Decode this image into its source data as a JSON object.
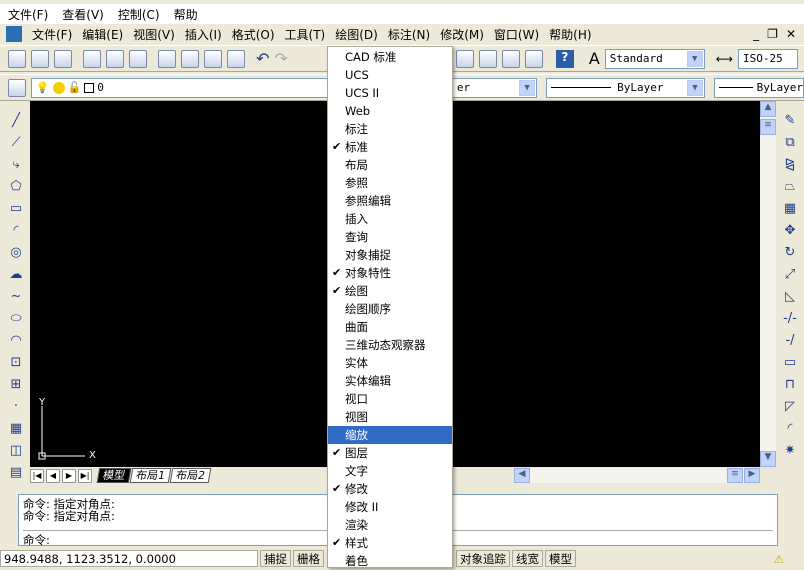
{
  "menubar": [
    "文件(F)",
    "查看(V)",
    "控制(C)",
    "帮助"
  ],
  "menubar2": [
    "文件(F)",
    "编辑(E)",
    "视图(V)",
    "插入(I)",
    "格式(O)",
    "工具(T)",
    "绘图(D)",
    "标注(N)",
    "修改(M)",
    "窗口(W)",
    "帮助(H)"
  ],
  "window_controls": [
    "_",
    "❐",
    "✕"
  ],
  "toolbar": {
    "text_style": "Standard",
    "dim_style": "ISO-25"
  },
  "layer": {
    "current": "0",
    "color": "er",
    "linetype": "ByLayer",
    "lineweight": "ByLayer"
  },
  "menu": {
    "items": [
      {
        "label": "CAD 标准",
        "checked": false
      },
      {
        "label": "UCS",
        "checked": false
      },
      {
        "label": "UCS II",
        "checked": false
      },
      {
        "label": "Web",
        "checked": false
      },
      {
        "label": "标注",
        "checked": false
      },
      {
        "label": "标准",
        "checked": true
      },
      {
        "label": "布局",
        "checked": false
      },
      {
        "label": "参照",
        "checked": false
      },
      {
        "label": "参照编辑",
        "checked": false
      },
      {
        "label": "插入",
        "checked": false
      },
      {
        "label": "查询",
        "checked": false
      },
      {
        "label": "对象捕捉",
        "checked": false
      },
      {
        "label": "对象特性",
        "checked": true
      },
      {
        "label": "绘图",
        "checked": true
      },
      {
        "label": "绘图顺序",
        "checked": false
      },
      {
        "label": "曲面",
        "checked": false
      },
      {
        "label": "三维动态观察器",
        "checked": false
      },
      {
        "label": "实体",
        "checked": false
      },
      {
        "label": "实体编辑",
        "checked": false
      },
      {
        "label": "视口",
        "checked": false
      },
      {
        "label": "视图",
        "checked": false
      },
      {
        "label": "缩放",
        "checked": false,
        "highlighted": true
      },
      {
        "label": "图层",
        "checked": true
      },
      {
        "label": "文字",
        "checked": false
      },
      {
        "label": "修改",
        "checked": true
      },
      {
        "label": "修改 II",
        "checked": false
      },
      {
        "label": "渲染",
        "checked": false
      },
      {
        "label": "样式",
        "checked": true
      },
      {
        "label": "着色",
        "checked": false
      }
    ]
  },
  "axes": {
    "x": "X",
    "y": "Y"
  },
  "tabs": [
    {
      "label": "模型",
      "active": true
    },
    {
      "label": "布局1",
      "active": false
    },
    {
      "label": "布局2",
      "active": false
    }
  ],
  "command": {
    "lines": [
      "命令: 指定对角点:",
      "命令: 指定对角点:"
    ],
    "prompt": "命令:"
  },
  "status": {
    "coords": "948.9488,  1123.3512, 0.0000",
    "buttons_left": [
      "捕捉",
      "栅格"
    ],
    "buttons_right": [
      "对象追踪",
      "线宽",
      "模型"
    ]
  },
  "colors": {
    "canvas": "#000000",
    "highlight": "#316ac5"
  }
}
